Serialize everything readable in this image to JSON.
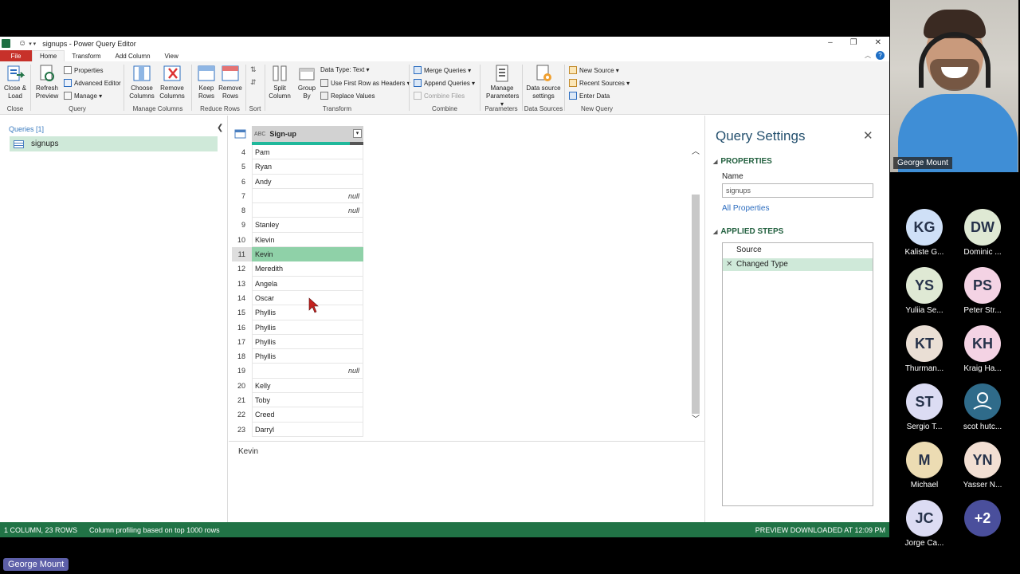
{
  "window": {
    "title": "signups - Power Query Editor"
  },
  "tabs": [
    "File",
    "Home",
    "Transform",
    "Add Column",
    "View"
  ],
  "ribbon": {
    "close": {
      "close_load": "Close &",
      "close_load2": "Load",
      "label": "Close"
    },
    "query": {
      "refresh": "Refresh",
      "refresh2": "Preview",
      "properties": "Properties",
      "advanced_editor": "Advanced Editor",
      "manage": "Manage",
      "label": "Query"
    },
    "manage_columns": {
      "choose": "Choose",
      "choose2": "Columns",
      "remove": "Remove",
      "remove2": "Columns",
      "label": "Manage Columns"
    },
    "reduce_rows": {
      "keep": "Keep",
      "keep2": "Rows",
      "remove": "Remove",
      "remove2": "Rows",
      "label": "Reduce Rows"
    },
    "sort": {
      "label": "Sort"
    },
    "transform": {
      "split": "Split",
      "split2": "Column",
      "group": "Group",
      "group2": "By",
      "data_type": "Data Type: Text",
      "first_row": "Use First Row as Headers",
      "replace": "Replace Values",
      "label": "Transform"
    },
    "combine": {
      "merge": "Merge Queries",
      "append": "Append Queries",
      "combine_files": "Combine Files",
      "label": "Combine"
    },
    "parameters": {
      "manage": "Manage",
      "manage2": "Parameters",
      "label": "Parameters"
    },
    "data_sources": {
      "settings": "Data source",
      "settings2": "settings",
      "label": "Data Sources"
    },
    "new_query": {
      "new_source": "New Source",
      "recent": "Recent Sources",
      "enter": "Enter Data",
      "label": "New Query"
    }
  },
  "queries": {
    "header": "Queries [1]",
    "items": [
      "signups"
    ]
  },
  "grid": {
    "column_type": "ABC",
    "column_name": "Sign-up",
    "rows": [
      {
        "n": "4",
        "v": "Pam",
        "null": false
      },
      {
        "n": "5",
        "v": "Ryan",
        "null": false
      },
      {
        "n": "6",
        "v": "Andy",
        "null": false
      },
      {
        "n": "7",
        "v": "null",
        "null": true
      },
      {
        "n": "8",
        "v": "null",
        "null": true
      },
      {
        "n": "9",
        "v": "Stanley",
        "null": false
      },
      {
        "n": "10",
        "v": "Klevin",
        "null": false
      },
      {
        "n": "11",
        "v": "Kevin",
        "null": false,
        "selected": true
      },
      {
        "n": "12",
        "v": "Meredith",
        "null": false
      },
      {
        "n": "13",
        "v": "Angela",
        "null": false
      },
      {
        "n": "14",
        "v": "Oscar",
        "null": false
      },
      {
        "n": "15",
        "v": "Phyllis",
        "null": false
      },
      {
        "n": "16",
        "v": "Phyllis",
        "null": false
      },
      {
        "n": "17",
        "v": "Phyllis",
        "null": false
      },
      {
        "n": "18",
        "v": "Phyllis",
        "null": false
      },
      {
        "n": "19",
        "v": "null",
        "null": true
      },
      {
        "n": "20",
        "v": "Kelly",
        "null": false
      },
      {
        "n": "21",
        "v": "Toby",
        "null": false
      },
      {
        "n": "22",
        "v": "Creed",
        "null": false
      },
      {
        "n": "23",
        "v": "Darryl",
        "null": false
      }
    ],
    "preview_value": "Kevin"
  },
  "query_settings": {
    "title": "Query Settings",
    "properties_header": "PROPERTIES",
    "name_label": "Name",
    "name_value": "signups",
    "all_properties": "All Properties",
    "applied_steps_header": "APPLIED STEPS",
    "steps": [
      "Source",
      "Changed Type"
    ]
  },
  "status": {
    "columns_rows": "1 COLUMN, 23 ROWS",
    "profiling": "Column profiling based on top 1000 rows",
    "preview": "PREVIEW DOWNLOADED AT 12:09 PM"
  },
  "meeting": {
    "speaker": "George Mount",
    "bottom_name": "George Mount",
    "participants": [
      {
        "initials": "KG",
        "name": "Kaliste G...",
        "color": "#cfe0f7"
      },
      {
        "initials": "DW",
        "name": "Dominic ...",
        "color": "#dfe9d4"
      },
      {
        "initials": "YS",
        "name": "Yuliia Se...",
        "color": "#dfe9d4"
      },
      {
        "initials": "PS",
        "name": "Peter Str...",
        "color": "#f4d3e4"
      },
      {
        "initials": "KT",
        "name": "Thurman...",
        "color": "#eadfd5"
      },
      {
        "initials": "KH",
        "name": "Kraig Ha...",
        "color": "#f4d3e4"
      },
      {
        "initials": "ST",
        "name": "Sergio T...",
        "color": "#dcdcf3"
      },
      {
        "initials": "",
        "name": "scot hutc...",
        "color": "#2f6b8a"
      },
      {
        "initials": "M",
        "name": "Michael",
        "color": "#ecdcb3"
      },
      {
        "initials": "YN",
        "name": "Yasser N...",
        "color": "#f2dfd3"
      },
      {
        "initials": "JC",
        "name": "Jorge Ca...",
        "color": "#dcdcf3"
      },
      {
        "initials": "+2",
        "name": "",
        "color": "#4a4f9c"
      }
    ]
  },
  "colors": {
    "accent_green": "#217346",
    "file_red": "#c7312a",
    "selection": "#8fd1a8"
  }
}
